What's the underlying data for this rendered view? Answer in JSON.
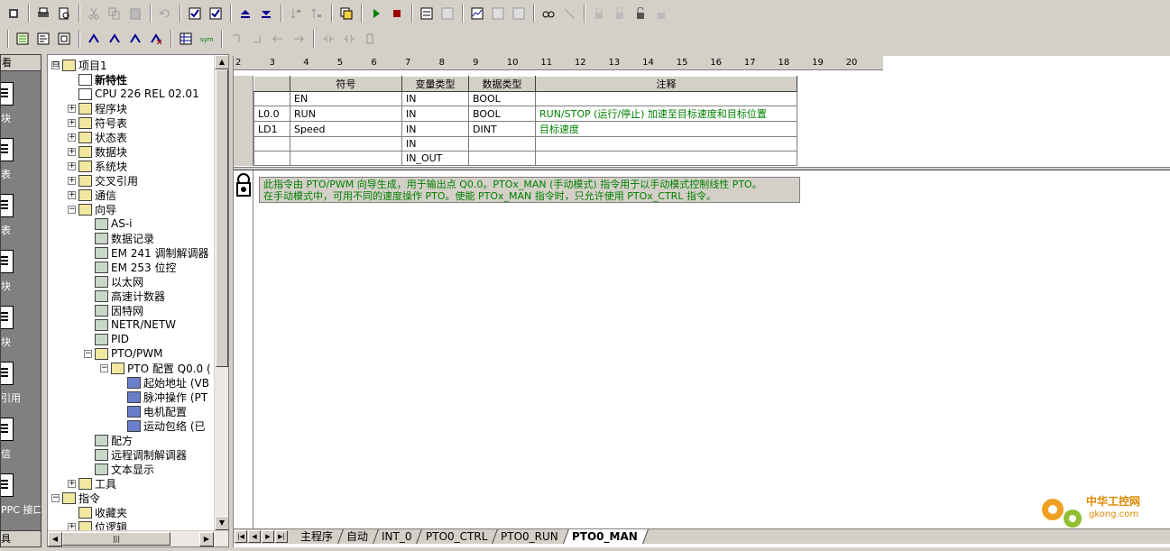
{
  "navbar": {
    "head": "看",
    "items": [
      {
        "label": "块",
        "icon": "program-block-icon"
      },
      {
        "label": "表",
        "icon": "symbol-table-icon"
      },
      {
        "label": "表",
        "icon": "status-chart-icon"
      },
      {
        "label": "块",
        "icon": "data-block-icon"
      },
      {
        "label": "块",
        "icon": "system-block-icon"
      },
      {
        "label": "引用",
        "icon": "cross-reference-icon"
      },
      {
        "label": "信",
        "icon": "communication-icon"
      },
      {
        "label": "PPC 接口",
        "icon": "pg-pc-interface-icon"
      }
    ],
    "foot": "具"
  },
  "tree": {
    "items": [
      {
        "label": "项目1",
        "exp": "⊟",
        "indent": 0,
        "bold": false,
        "icon": "project-icon"
      },
      {
        "label": "新特性",
        "exp": "",
        "indent": 1,
        "bold": true,
        "icon": "help-icon"
      },
      {
        "label": "CPU 226 REL 02.01",
        "exp": "",
        "indent": 1,
        "bold": false,
        "icon": "cpu-icon"
      },
      {
        "label": "程序块",
        "exp": "+",
        "indent": 1,
        "bold": false,
        "icon": "program-block-icon"
      },
      {
        "label": "符号表",
        "exp": "+",
        "indent": 1,
        "bold": false,
        "icon": "symbol-table-icon"
      },
      {
        "label": "状态表",
        "exp": "+",
        "indent": 1,
        "bold": false,
        "icon": "status-chart-icon"
      },
      {
        "label": "数据块",
        "exp": "+",
        "indent": 1,
        "bold": false,
        "icon": "data-block-icon"
      },
      {
        "label": "系统块",
        "exp": "+",
        "indent": 1,
        "bold": false,
        "icon": "system-block-icon"
      },
      {
        "label": "交叉引用",
        "exp": "+",
        "indent": 1,
        "bold": false,
        "icon": "cross-reference-icon"
      },
      {
        "label": "通信",
        "exp": "+",
        "indent": 1,
        "bold": false,
        "icon": "communication-icon"
      },
      {
        "label": "向导",
        "exp": "−",
        "indent": 1,
        "bold": false,
        "icon": "wizard-icon"
      },
      {
        "label": "AS-i",
        "exp": "",
        "indent": 2,
        "bold": false,
        "icon": "wizard-item-icon"
      },
      {
        "label": "数据记录",
        "exp": "",
        "indent": 2,
        "bold": false,
        "icon": "wizard-item-icon"
      },
      {
        "label": "EM 241 调制解调器",
        "exp": "",
        "indent": 2,
        "bold": false,
        "icon": "wizard-item-icon"
      },
      {
        "label": "EM 253 位控",
        "exp": "",
        "indent": 2,
        "bold": false,
        "icon": "wizard-item-icon"
      },
      {
        "label": "以太网",
        "exp": "",
        "indent": 2,
        "bold": false,
        "icon": "wizard-item-icon"
      },
      {
        "label": "高速计数器",
        "exp": "",
        "indent": 2,
        "bold": false,
        "icon": "wizard-item-icon"
      },
      {
        "label": "因特网",
        "exp": "",
        "indent": 2,
        "bold": false,
        "icon": "wizard-item-icon"
      },
      {
        "label": "NETR/NETW",
        "exp": "",
        "indent": 2,
        "bold": false,
        "icon": "wizard-item-icon"
      },
      {
        "label": "PID",
        "exp": "",
        "indent": 2,
        "bold": false,
        "icon": "wizard-item-icon"
      },
      {
        "label": "PTO/PWM",
        "exp": "−",
        "indent": 2,
        "bold": false,
        "icon": "pto-pwm-icon"
      },
      {
        "label": "PTO 配置 Q0.0 (",
        "exp": "−",
        "indent": 3,
        "bold": false,
        "icon": "pto-config-icon"
      },
      {
        "label": "起始地址 (VB",
        "exp": "",
        "indent": 4,
        "bold": false,
        "icon": "page-icon"
      },
      {
        "label": "脉冲操作 (PT",
        "exp": "",
        "indent": 4,
        "bold": false,
        "icon": "page-icon"
      },
      {
        "label": "电机配置",
        "exp": "",
        "indent": 4,
        "bold": false,
        "icon": "page-icon"
      },
      {
        "label": "运动包络 (已",
        "exp": "",
        "indent": 4,
        "bold": false,
        "icon": "page-icon"
      },
      {
        "label": "配方",
        "exp": "",
        "indent": 2,
        "bold": false,
        "icon": "wizard-item-icon"
      },
      {
        "label": "远程调制解调器",
        "exp": "",
        "indent": 2,
        "bold": false,
        "icon": "wizard-item-icon"
      },
      {
        "label": "文本显示",
        "exp": "",
        "indent": 2,
        "bold": false,
        "icon": "wizard-item-icon"
      },
      {
        "label": "工具",
        "exp": "+",
        "indent": 1,
        "bold": false,
        "icon": "tools-icon"
      },
      {
        "label": "指令",
        "exp": "−",
        "indent": 0,
        "bold": false,
        "icon": "instructions-icon"
      },
      {
        "label": "收藏夹",
        "exp": "",
        "indent": 1,
        "bold": false,
        "icon": "favorites-icon"
      },
      {
        "label": "位逻辑",
        "exp": "+",
        "indent": 1,
        "bold": false,
        "icon": "bit-logic-icon"
      }
    ]
  },
  "ruler": {
    "ticks": [
      "2",
      "3",
      "4",
      "5",
      "6",
      "7",
      "8",
      "9",
      "10",
      "11",
      "12",
      "13",
      "14",
      "15",
      "16",
      "17",
      "18",
      "19",
      "20"
    ]
  },
  "vartable": {
    "headers": [
      "",
      "符号",
      "变量类型",
      "数据类型",
      "注释"
    ],
    "rows": [
      {
        "addr": "",
        "symbol": "EN",
        "vartype": "IN",
        "datatype": "BOOL",
        "comment": ""
      },
      {
        "addr": "L0.0",
        "symbol": "RUN",
        "vartype": "IN",
        "datatype": "BOOL",
        "comment": "RUN/STOP (运行/停止) 加速至目标速度和目标位置"
      },
      {
        "addr": "LD1",
        "symbol": "Speed",
        "vartype": "IN",
        "datatype": "DINT",
        "comment": "目标速度"
      },
      {
        "addr": "",
        "symbol": "",
        "vartype": "IN",
        "datatype": "",
        "comment": ""
      },
      {
        "addr": "",
        "symbol": "",
        "vartype": "IN_OUT",
        "datatype": "",
        "comment": ""
      }
    ]
  },
  "program_comment": {
    "line1": "此指令由 PTO/PWM 向导生成，用于输出点 Q0.0。PTOx_MAN (手动模式) 指令用于以手动模式控制线性 PTO。",
    "line2": "在手动模式中，可用不同的速度操作 PTO。使能 PTOx_MAN 指令时，只允许使用 PTOx_CTRL 指令。"
  },
  "tabs": [
    {
      "label": "主程序",
      "active": false
    },
    {
      "label": "自动",
      "active": false
    },
    {
      "label": "INT_0",
      "active": false
    },
    {
      "label": "PTO0_CTRL",
      "active": false
    },
    {
      "label": "PTO0_RUN",
      "active": false
    },
    {
      "label": "PTO0_MAN",
      "active": true
    }
  ],
  "watermark": {
    "title": "中华工控网",
    "sub": "gkong.com"
  },
  "colors": {
    "chrome": "#d4d0c8",
    "comment_green": "#008000",
    "watermark_orange": "#e08800"
  }
}
